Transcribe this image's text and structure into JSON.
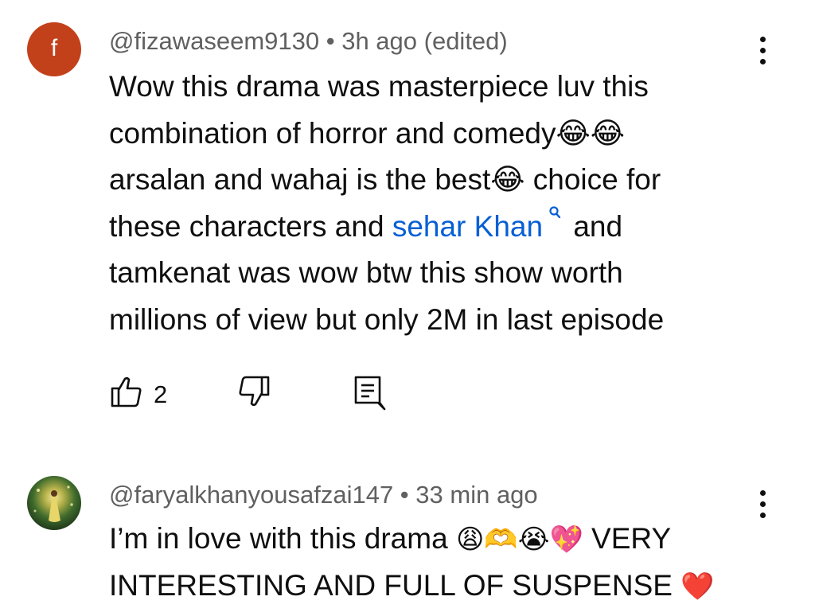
{
  "comments": [
    {
      "avatar_letter": "f",
      "avatar_color": "#c2411b",
      "handle": "@fizawaseem9130",
      "separator": " • ",
      "time": "3h ago (edited)",
      "lines": {
        "l1": "Wow this drama was masterpiece luv this",
        "l2": "combination of horror and comedy😂😂",
        "l3a": "arsalan and wahaj is the best😂",
        "l3b": " choice for",
        "l4a": "these characters and ",
        "l4_link": "sehar Khan",
        "l4b": " and",
        "l5": "tamkenat was wow btw this show worth",
        "l6": "millions of view but only 2M in last episode"
      },
      "like_count": "2",
      "icons": [
        "thumbs-up-icon",
        "thumbs-down-icon",
        "reply-icon",
        "more-vert-icon",
        "search-icon"
      ]
    },
    {
      "handle": "@faryalkhanyousafzai147",
      "separator": " • ",
      "time": "33 min ago",
      "lines": {
        "l1a": "I’m in love with this drama ",
        "l1_emoji": "😩🫶😭💖",
        "l1b": " VERY",
        "l2a": "INTERESTING AND FULL OF SUSPENSE ",
        "l2_emoji": "❤️"
      },
      "icons": [
        "avatar-image",
        "more-vert-icon"
      ]
    }
  ],
  "colors": {
    "link": "#065fd4",
    "meta": "#606060",
    "text": "#0f0f0f"
  }
}
